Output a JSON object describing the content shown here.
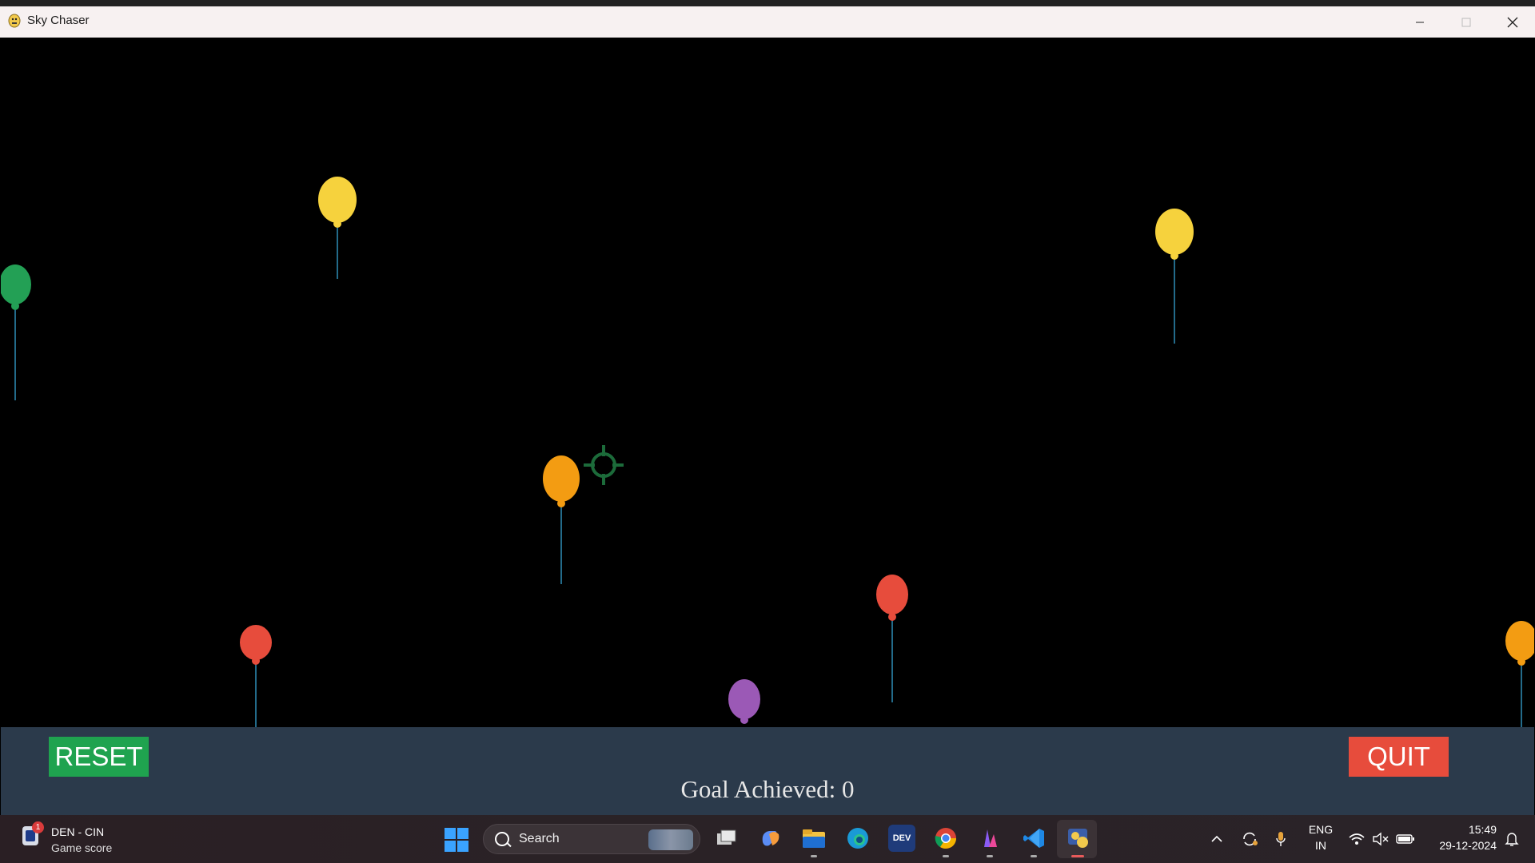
{
  "window": {
    "title": "Sky Chaser"
  },
  "game": {
    "goal_label": "Goal Achieved: 0",
    "reset_label": "RESET",
    "quit_label": "QUIT"
  },
  "taskbar": {
    "widget_title": "DEN - CIN",
    "widget_subtitle": "Game score",
    "widget_badge": "1",
    "search_label": "Search",
    "language_line1": "ENG",
    "language_line2": "IN",
    "time": "15:49",
    "date": "29-12-2024"
  }
}
